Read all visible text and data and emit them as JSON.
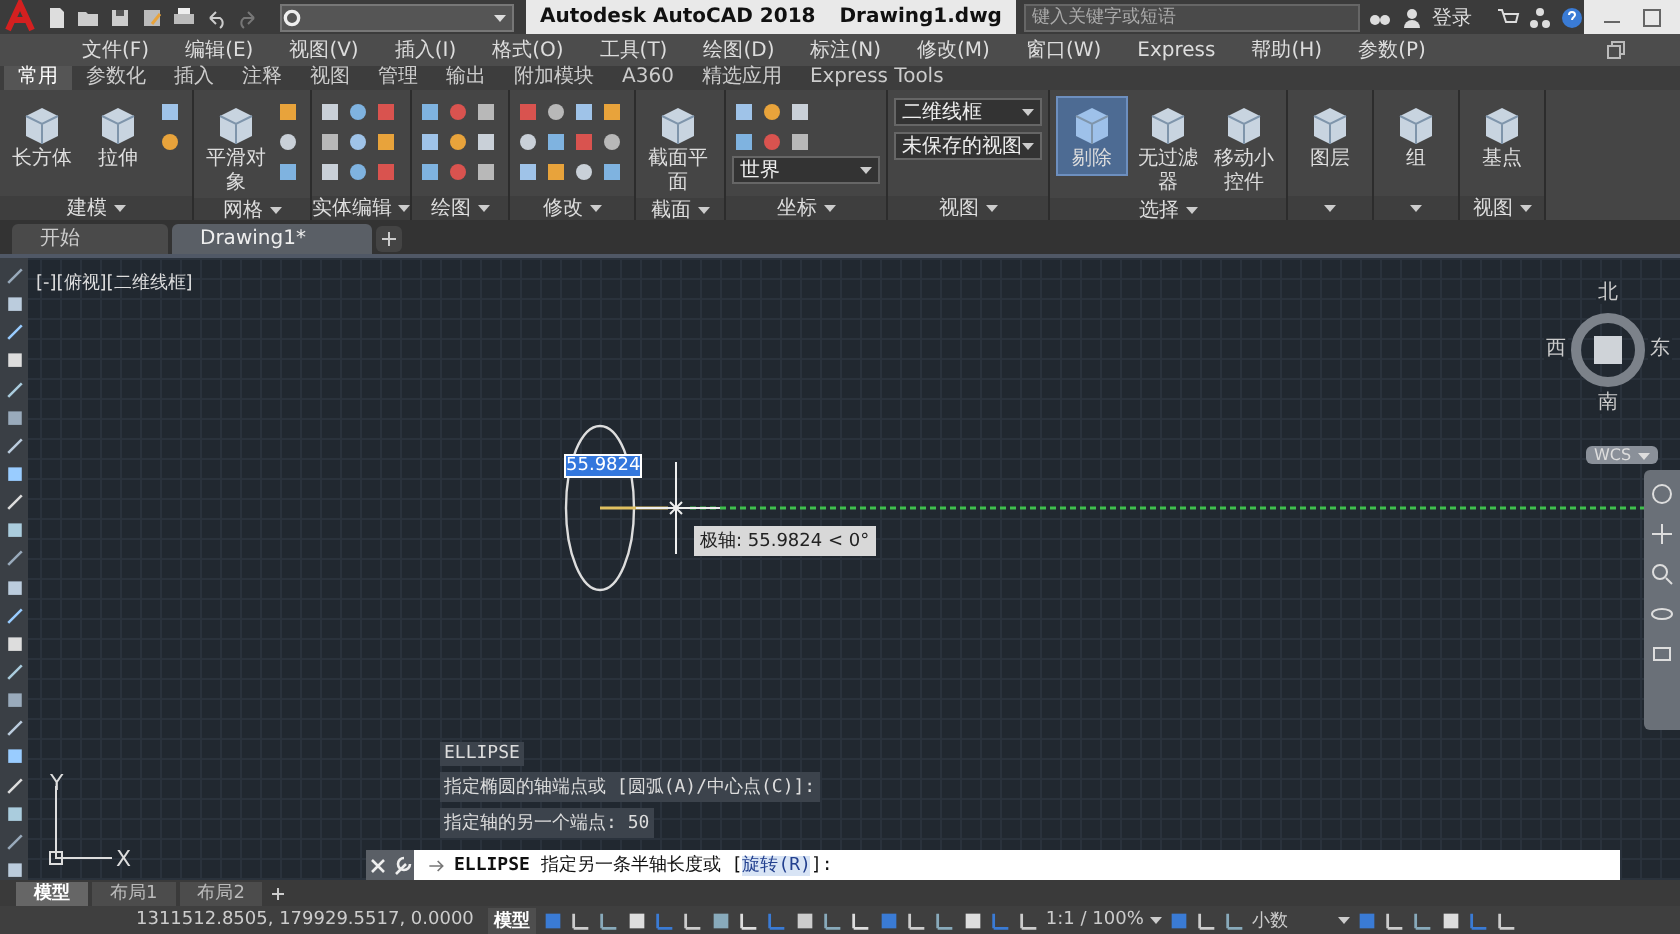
{
  "title_bar": {
    "app": "Autodesk AutoCAD 2018",
    "file": "Drawing1.dwg",
    "search": {
      "placeholder": "键入关键字或短语"
    },
    "sign_in": "登录"
  },
  "menu": [
    "文件(F)",
    "编辑(E)",
    "视图(V)",
    "插入(I)",
    "格式(O)",
    "工具(T)",
    "绘图(D)",
    "标注(N)",
    "修改(M)",
    "窗口(W)",
    "Express",
    "帮助(H)",
    "参数(P)"
  ],
  "ribbon_tabs": [
    {
      "label": "常用",
      "selected": true
    },
    {
      "label": "参数化",
      "selected": false
    },
    {
      "label": "插入",
      "selected": false
    },
    {
      "label": "注释",
      "selected": false
    },
    {
      "label": "视图",
      "selected": false
    },
    {
      "label": "管理",
      "selected": false
    },
    {
      "label": "输出",
      "selected": false
    },
    {
      "label": "附加模块",
      "selected": false
    },
    {
      "label": "A360",
      "selected": false
    },
    {
      "label": "精选应用",
      "selected": false
    },
    {
      "label": "Express Tools",
      "selected": false
    }
  ],
  "ribbon_panels": [
    {
      "title": "建模",
      "kind": "tools",
      "buttons": [
        {
          "label": "长方体",
          "active": false
        },
        {
          "label": "拉伸",
          "active": false
        }
      ]
    },
    {
      "title": "网格",
      "kind": "tools",
      "buttons": [
        {
          "label": "平滑对象",
          "active": false
        }
      ]
    },
    {
      "title": "实体编辑",
      "kind": "tools"
    },
    {
      "title": "绘图",
      "kind": "tools"
    },
    {
      "title": "修改",
      "kind": "tools"
    },
    {
      "title": "截面",
      "kind": "tools",
      "buttons": [
        {
          "label": "截面平面",
          "active": false
        }
      ]
    },
    {
      "title": "坐标",
      "kind": "tools",
      "dropdown": "世界"
    },
    {
      "title": "视图",
      "kind": "views",
      "dropdowns": [
        "二维线框",
        "未保存的视图"
      ]
    },
    {
      "title": "选择",
      "kind": "buttons",
      "buttons": [
        {
          "label": "剔除",
          "active": true
        },
        {
          "label": "无过滤器",
          "active": false
        },
        {
          "label": "移动小控件",
          "active": false
        }
      ]
    },
    {
      "kind": "buttons",
      "buttons": [
        {
          "label": "图层",
          "active": false
        }
      ]
    },
    {
      "kind": "buttons",
      "buttons": [
        {
          "label": "组",
          "active": false
        }
      ]
    },
    {
      "title": "视图",
      "kind": "buttons",
      "buttons": [
        {
          "label": "基点",
          "active": false
        }
      ]
    }
  ],
  "doc_tabs": [
    {
      "label": "开始",
      "selected": false
    },
    {
      "label": "Drawing1*",
      "selected": true
    }
  ],
  "viewport": {
    "label": "[-][俯视][二维线框]",
    "view_cube": {
      "north": "北",
      "south": "南",
      "east": "东",
      "west": "西"
    },
    "wcs": "WCS",
    "input_value": "55.9824",
    "tooltip": "极轴: 55.9824 < 0°",
    "ucs": {
      "x": "X",
      "y": "Y"
    }
  },
  "command_history": [
    "ELLIPSE",
    "指定椭圆的轴端点或 [圆弧(A)/中心点(C)]:",
    "指定轴的另一个端点: 50"
  ],
  "command_line": {
    "command": "ELLIPSE",
    "prompt": "指定另一条半轴长度或 [",
    "option": "旋转(R)",
    "suffix": "]:"
  },
  "layout_tabs": [
    {
      "label": "模型",
      "selected": true
    },
    {
      "label": "布局1",
      "selected": false
    },
    {
      "label": "布局2",
      "selected": false
    }
  ],
  "status_bar": {
    "coordinates": "1311512.8505, 179929.5517, 0.0000",
    "model": "模型",
    "scale": "1:1 / 100%",
    "units": "小数"
  }
}
